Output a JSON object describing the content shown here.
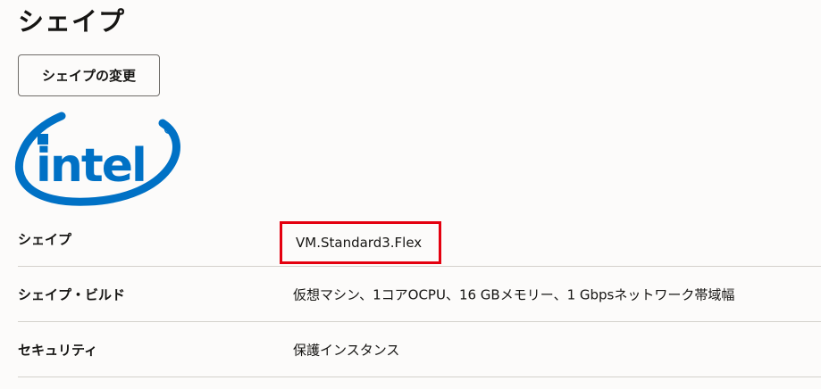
{
  "section": {
    "title": "シェイプ"
  },
  "buttons": {
    "change_shape_label": "シェイプの変更"
  },
  "logo": {
    "icon": "intel-logo",
    "text": "intel",
    "color": "#0071c5"
  },
  "details": {
    "rows": [
      {
        "label": "シェイプ",
        "value": "VM.Standard3.Flex",
        "highlighted": true
      },
      {
        "label": "シェイプ・ビルド",
        "value": "仮想マシン、1コアOCPU、16 GBメモリー、1 Gbpsネットワーク帯域幅"
      },
      {
        "label": "セキュリティ",
        "value": "保護インスタンス"
      }
    ]
  },
  "colors": {
    "background": "#fcfbfa",
    "text": "#161513",
    "highlight_border": "#e4000f",
    "divider": "#d4d1cc"
  }
}
